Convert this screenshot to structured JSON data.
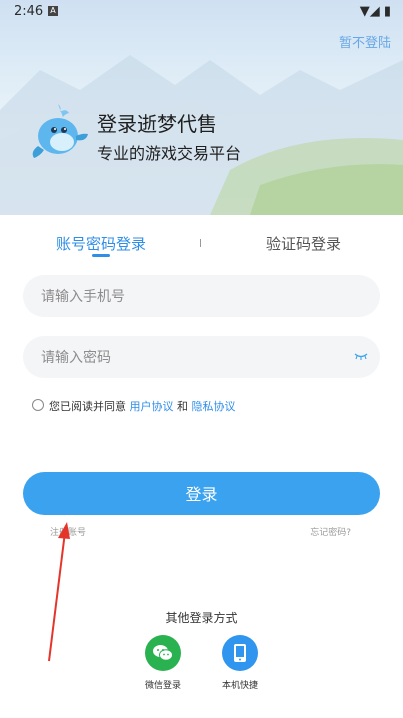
{
  "status_bar": {
    "time": "2:46",
    "app_badge": "A",
    "system_icons": "▼◢ ▮"
  },
  "header": {
    "skip_label": "暂不登陆",
    "title": "登录逝梦代售",
    "subtitle": "专业的游戏交易平台"
  },
  "tabs": [
    {
      "label": "账号密码登录",
      "active": true
    },
    {
      "label": "验证码登录",
      "active": false
    }
  ],
  "form": {
    "phone_placeholder": "请输入手机号",
    "phone_value": "",
    "password_placeholder": "请输入密码",
    "password_value": "",
    "agreement_checked": false,
    "agreement_prefix": "您已阅读并同意 ",
    "user_agreement": "用户协议",
    "agreement_and": " 和 ",
    "privacy_policy": "隐私协议",
    "login_button": "登录",
    "register_link": "注册账号",
    "forgot_link": "忘记密码?"
  },
  "other_login": {
    "title": "其他登录方式",
    "options": [
      {
        "label": "微信登录",
        "icon": "wechat-icon",
        "color": "#2ab150"
      },
      {
        "label": "本机快捷",
        "icon": "phone-icon",
        "color": "#2f95ef"
      }
    ]
  },
  "colors": {
    "accent": "#2f8ee8",
    "button": "#3aa2ef",
    "annotation_arrow": "#e5352b"
  }
}
